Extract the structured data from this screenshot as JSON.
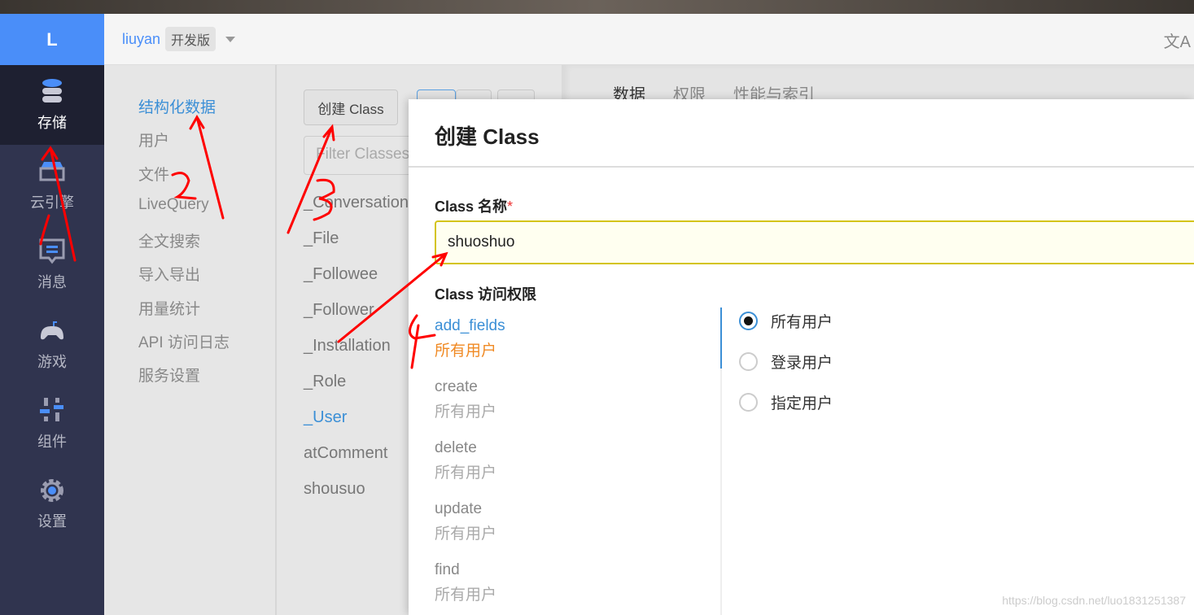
{
  "logo": "L",
  "sidebar": {
    "items": [
      {
        "label": "存储",
        "icon": "database-icon",
        "active": true
      },
      {
        "label": "云引擎",
        "icon": "cloud-engine-icon"
      },
      {
        "label": "消息",
        "icon": "message-icon"
      },
      {
        "label": "游戏",
        "icon": "gamepad-icon"
      },
      {
        "label": "组件",
        "icon": "components-icon"
      },
      {
        "label": "设置",
        "icon": "gear-icon"
      }
    ]
  },
  "topbar": {
    "app_name": "liuyan",
    "edition": "开发版",
    "translate_icon": "文A"
  },
  "subnav": [
    "结构化数据",
    "用户",
    "文件",
    "LiveQuery",
    "全文搜索",
    "导入导出",
    "用量统计",
    "API 访问日志",
    "服务设置"
  ],
  "classes": {
    "create_label": "创建 Class",
    "filter_placeholder": "Filter Classes",
    "list": [
      "_Conversation",
      "_File",
      "_Followee",
      "_Follower",
      "_Installation",
      "_Role",
      "_User",
      "atComment",
      "shousuo"
    ]
  },
  "tabs": [
    "数据",
    "权限",
    "性能与索引"
  ],
  "modal": {
    "title": "创建 Class",
    "name_label": "Class 名称",
    "required_mark": "*",
    "name_value": "shuoshuo",
    "access_label": "Class 访问权限",
    "permissions": [
      {
        "name": "add_fields",
        "value": "所有用户"
      },
      {
        "name": "create",
        "value": "所有用户"
      },
      {
        "name": "delete",
        "value": "所有用户"
      },
      {
        "name": "update",
        "value": "所有用户"
      },
      {
        "name": "find",
        "value": "所有用户"
      }
    ],
    "options": [
      "所有用户",
      "登录用户",
      "指定用户"
    ],
    "selected_option": "所有用户"
  },
  "watermark": "https://blog.csdn.net/luo1831251387",
  "colors": {
    "accent": "#3b8fd6",
    "sidebar": "#30344f",
    "highlight": "#f08a24",
    "annotation": "#ff0000"
  }
}
